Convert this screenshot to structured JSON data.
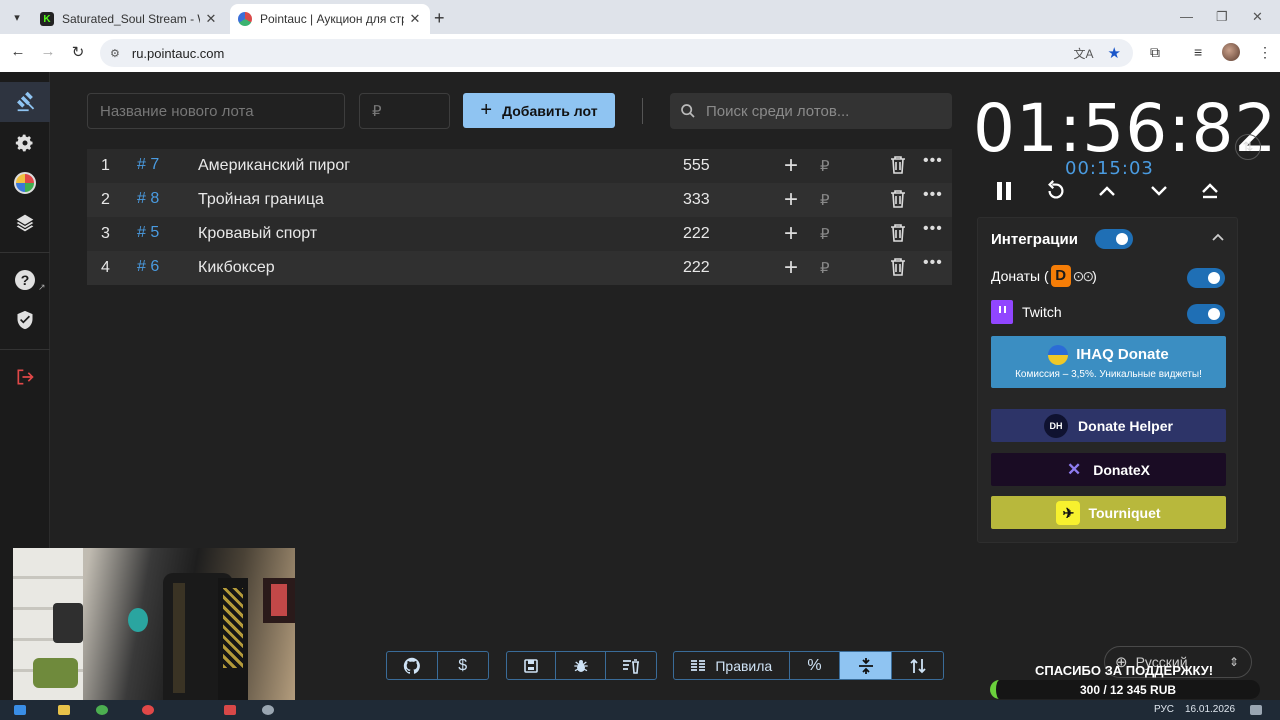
{
  "browser": {
    "tabs": [
      {
        "title": "Saturated_Soul Stream - Watch",
        "favicon_color": "#2a2a2a"
      },
      {
        "title": "Pointauc | Аукцион для стриме",
        "favicon_color": "#d94a4a"
      }
    ],
    "url": "ru.pointauc.com"
  },
  "sidebar": {
    "items": [
      "auction-icon",
      "settings-icon",
      "wheel-icon",
      "layers-icon",
      "help-icon",
      "shield-icon",
      "logout-icon"
    ]
  },
  "toolbar": {
    "lot_name_placeholder": "Название нового лота",
    "amount_placeholder": "₽",
    "add_button": "Добавить лот",
    "search_placeholder": "Поиск среди лотов..."
  },
  "lots": [
    {
      "index": "1",
      "id": "# 7",
      "name": "Американский пирог",
      "amount": "555"
    },
    {
      "index": "2",
      "id": "# 8",
      "name": "Тройная граница",
      "amount": "333"
    },
    {
      "index": "3",
      "id": "# 5",
      "name": "Кровавый спорт",
      "amount": "222"
    },
    {
      "index": "4",
      "id": "# 6",
      "name": "Кикбоксер",
      "amount": "222"
    }
  ],
  "lot_currency": "₽",
  "timer": {
    "main": "01:56:82",
    "sub": "00:15:03"
  },
  "integrations": {
    "title": "Интеграции",
    "enabled": true,
    "donations_label": "Донаты (",
    "donations_suffix": ")",
    "twitch_label": "Twitch",
    "partners": [
      {
        "name": "IHAQ Donate",
        "subtitle": "Комиссия – 3,5%. Уникальные виджеты!",
        "color": "#3b8ec2"
      },
      {
        "name": "Donate Helper",
        "logo_text": "DH",
        "color": "#2d3468"
      },
      {
        "name": "DonateX",
        "color": "#1a0c24"
      },
      {
        "name": "Tourniquet",
        "color": "#b8b83c"
      }
    ]
  },
  "bottom_toolbar": {
    "rules_label": "Правила",
    "percent_label": "%"
  },
  "language": "Русский",
  "overlay": {
    "thanks": "СПАСИБО ЗА ПОДДЕРЖКУ!",
    "goal": "300 / 12 345 RUB",
    "goal_progress": 0.024
  },
  "taskbar": {
    "lang": "РУС",
    "date": "16.01.2026"
  },
  "colors": {
    "accent": "#8fc4f2",
    "link": "#4a9be0",
    "toggle": "#1f6fb5"
  }
}
